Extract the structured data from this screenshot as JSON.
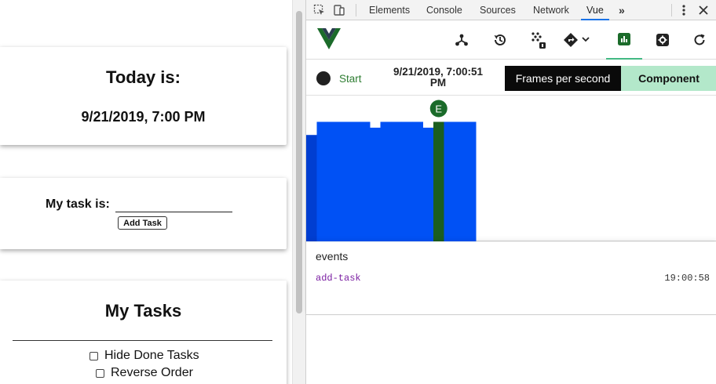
{
  "app": {
    "date_card": {
      "title": "Today is:",
      "date": "9/21/2019, 7:00 PM"
    },
    "task_card": {
      "label": "My task is:",
      "input_value": "",
      "button_label": "Add Task"
    },
    "tasks_card": {
      "title": "My Tasks",
      "options": [
        {
          "label": "Hide Done Tasks",
          "checked": false
        },
        {
          "label": "Reverse Order",
          "checked": false
        }
      ]
    }
  },
  "devtools": {
    "tabs": [
      {
        "label": "Elements",
        "active": false
      },
      {
        "label": "Console",
        "active": false
      },
      {
        "label": "Sources",
        "active": false
      },
      {
        "label": "Network",
        "active": false
      },
      {
        "label": "Vue",
        "active": true
      }
    ],
    "more_tabs_label": "»",
    "vue_toolbar": {
      "buttons": [
        "components-icon",
        "history-icon",
        "vuex-icon",
        "routing-icon",
        "performance-icon",
        "settings-icon",
        "refresh-icon"
      ],
      "active": "performance-icon"
    },
    "timeline": {
      "start_label": "Start",
      "timestamp": "9/21/2019, 7:00:51 PM",
      "fps_tab": "Frames per second",
      "component_tab": "Component"
    },
    "events": {
      "heading": "events",
      "items": [
        {
          "name": "add-task",
          "time": "19:00:58"
        }
      ]
    }
  },
  "colors": {
    "accent": "#42b983",
    "bar": "#0051f5",
    "bar_dark": "#003ed1",
    "event_bar": "#1b5e20",
    "event_marker": "#1b6b2a"
  },
  "chart_data": {
    "type": "bar",
    "title": "",
    "bars": [
      {
        "value": 0.73,
        "kind": "dark"
      },
      {
        "value": 0.82
      },
      {
        "value": 0.82
      },
      {
        "value": 0.82
      },
      {
        "value": 0.82
      },
      {
        "value": 0.82
      },
      {
        "value": 0.78
      },
      {
        "value": 0.82
      },
      {
        "value": 0.82
      },
      {
        "value": 0.82
      },
      {
        "value": 0.82
      },
      {
        "value": 0.78
      },
      {
        "value": 0.82,
        "event": "E"
      },
      {
        "value": 0.82
      },
      {
        "value": 0.82
      },
      {
        "value": 0.82
      }
    ],
    "ylim": [
      0,
      1
    ]
  }
}
